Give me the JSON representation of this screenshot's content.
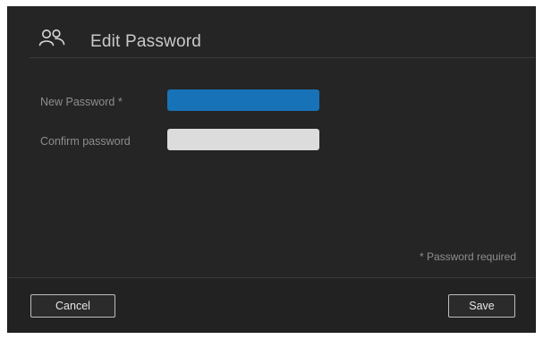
{
  "dialog": {
    "title": "Edit Password",
    "icon": "users-icon"
  },
  "form": {
    "new_password": {
      "label": "New Password *",
      "value": ""
    },
    "confirm_password": {
      "label": "Confirm password",
      "value": ""
    }
  },
  "required_note": "* Password required",
  "footer": {
    "cancel_label": "Cancel",
    "save_label": "Save"
  },
  "colors": {
    "dialog_background": "#252525",
    "active_field": "#1872b8",
    "inactive_field": "#dcdcdc",
    "title_text": "#c9c9c9",
    "label_text": "#8e8e8e"
  }
}
